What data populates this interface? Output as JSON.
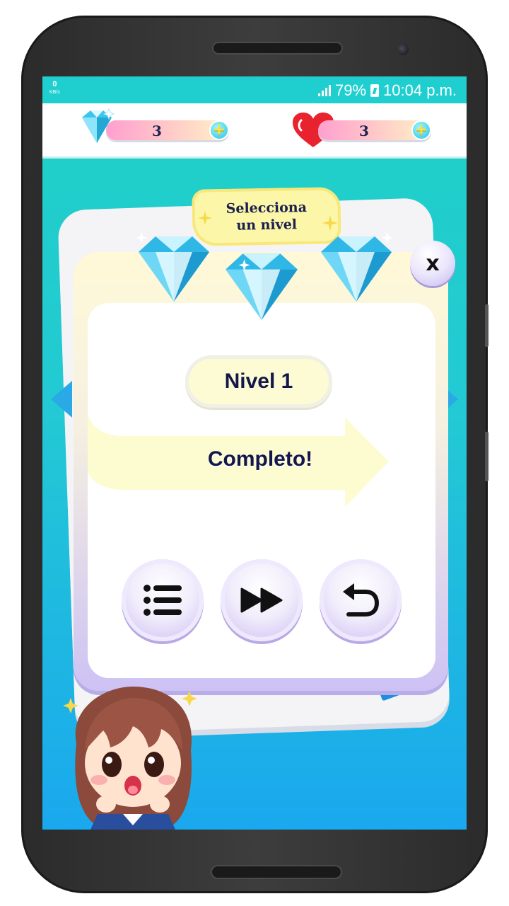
{
  "status_bar": {
    "data_speed": "0",
    "data_speed_unit": "KB/s",
    "battery": "79%",
    "time": "10:04 p.m."
  },
  "resources": {
    "gems": {
      "icon": "diamond-icon",
      "value": "3",
      "add_icon": "plus-icon"
    },
    "lives": {
      "icon": "heart-icon",
      "value": "3",
      "add_icon": "plus-icon"
    }
  },
  "level_select": {
    "title_line1": "Selecciona",
    "title_line2": "un nivel"
  },
  "dialog": {
    "close_label": "x",
    "level_label": "Nivel 1",
    "status_text": "Completo!",
    "stars_earned": 3,
    "buttons": [
      {
        "name": "menu",
        "icon": "list-icon"
      },
      {
        "name": "next",
        "icon": "fast-forward-icon"
      },
      {
        "name": "retry",
        "icon": "undo-icon"
      }
    ]
  },
  "colors": {
    "screen_top": "#1fd0c6",
    "screen_bottom": "#1aa8ee",
    "gem": "#38c6ee",
    "heart": "#e8222f",
    "text_dark": "#14174a",
    "dialog_lavender": "#cdc2f4"
  }
}
